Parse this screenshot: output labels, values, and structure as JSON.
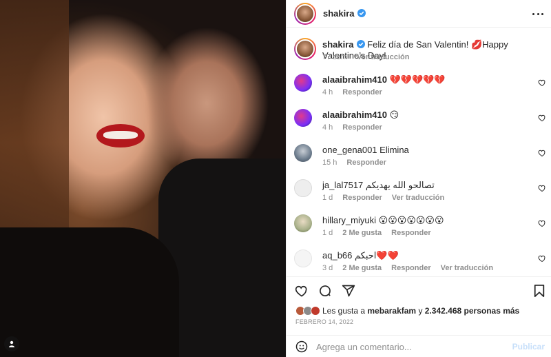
{
  "header": {
    "username": "shakira"
  },
  "caption": {
    "username": "shakira",
    "text": "Feliz día de San Valentin! 💋Happy Valentine’s Day!",
    "time": "77 sem",
    "translate": "Ver traducción"
  },
  "comments": [
    {
      "username": "alaaibrahim410",
      "text": "💔💔💔💔💔",
      "time": "4 h",
      "likes": "",
      "reply": "Responder",
      "translate": "",
      "avatar_color": "#7b2ff7"
    },
    {
      "username": "alaaibrahim410",
      "text": "😏",
      "time": "4 h",
      "likes": "",
      "reply": "Responder",
      "translate": "",
      "avatar_color": "#7b2ff7"
    },
    {
      "username": "one_gena001",
      "text": "Elimina",
      "time": "15 h",
      "likes": "",
      "reply": "Responder",
      "translate": "",
      "avatar_color": "#6b7b8c"
    },
    {
      "username": "ja_lal7517",
      "text": "تصالحو الله يهديكم",
      "time": "1 d",
      "likes": "",
      "reply": "Responder",
      "translate": "Ver traducción",
      "avatar_color": "#e0e0e0"
    },
    {
      "username": "hillary_miyuki",
      "text": "😮😮😮😮😮😮😮",
      "time": "1 d",
      "likes": "2 Me gusta",
      "reply": "Responder",
      "translate": "",
      "avatar_color": "#a8b08a"
    },
    {
      "username": "aq_b66",
      "text": "احبكم❤️❤️",
      "time": "3 d",
      "likes": "2 Me gusta",
      "reply": "Responder",
      "translate": "Ver traducción",
      "avatar_color": "#f2f2f2"
    }
  ],
  "likes": {
    "prefix": "Les gusta a",
    "user": "mebarakfam",
    "joiner": "y",
    "count": "2.342.468 personas más"
  },
  "date": "FEBRERO 14, 2022",
  "add_comment": {
    "placeholder": "Agrega un comentario...",
    "publish": "Publicar"
  },
  "colors": {
    "verified": "#3897f0",
    "muted": "#8e8e8e",
    "publish_disabled": "#c7dffa"
  }
}
